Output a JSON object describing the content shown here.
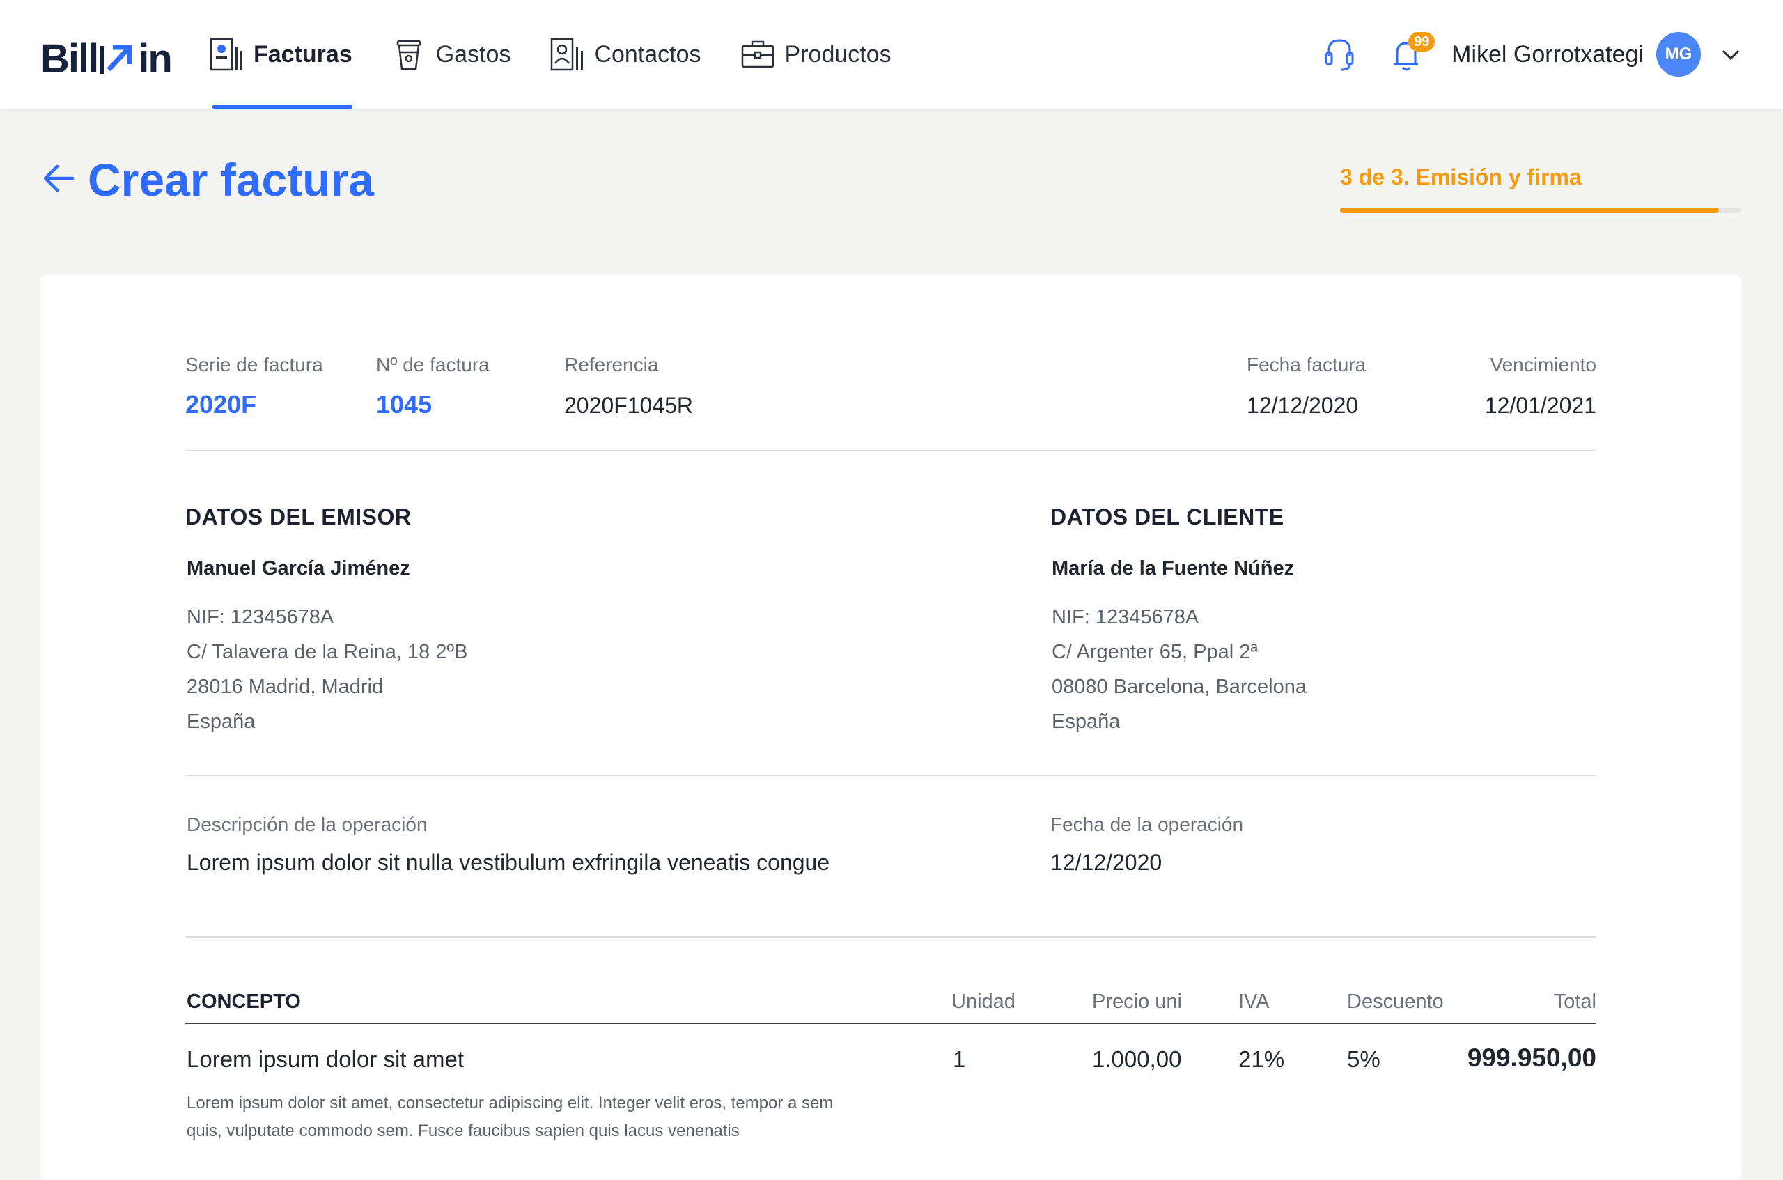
{
  "app": {
    "logo_left": "Bill",
    "logo_right": "in"
  },
  "nav": {
    "items": [
      {
        "label": "Facturas",
        "icon": "invoice-icon",
        "active": true
      },
      {
        "label": "Gastos",
        "icon": "cup-icon",
        "active": false
      },
      {
        "label": "Contactos",
        "icon": "contacts-icon",
        "active": false
      },
      {
        "label": "Productos",
        "icon": "briefcase-icon",
        "active": false
      }
    ]
  },
  "header_tools": {
    "notifications_count": "99",
    "user_name": "Mikel Gorrotxategi",
    "avatar_initials": "MG"
  },
  "page": {
    "title": "Crear factura",
    "step_label": "3 de 3. Emisión y firma",
    "step_progress": 0.945
  },
  "invoice": {
    "series_label": "Serie de factura",
    "series": "2020F",
    "number_label": "Nº de factura",
    "number": "1045",
    "reference_label": "Referencia",
    "reference": "2020F1045R",
    "date_label": "Fecha factura",
    "date": "12/12/2020",
    "due_label": "Vencimiento",
    "due": "12/01/2021",
    "issuer": {
      "title": "DATOS DEL EMISOR",
      "name": "Manuel García Jiménez",
      "nif": "NIF: 12345678A",
      "address": "C/ Talavera de la Reina, 18 2ºB",
      "city": "28016 Madrid, Madrid",
      "country": "España"
    },
    "client": {
      "title": "DATOS DEL CLIENTE",
      "name": "María de la Fuente Núñez",
      "nif": "NIF: 12345678A",
      "address": "C/ Argenter 65, Ppal 2ª",
      "city": "08080 Barcelona, Barcelona",
      "country": "España"
    },
    "operation_desc_label": "Descripción de la operación",
    "operation_desc": "Lorem ipsum dolor sit nulla vestibulum exfringila veneatis congue",
    "operation_date_label": "Fecha de la operación",
    "operation_date": "12/12/2020",
    "table": {
      "headers": {
        "concept": "CONCEPTO",
        "unit": "Unidad",
        "price": "Precio uni",
        "vat": "IVA",
        "discount": "Descuento",
        "total": "Total"
      },
      "rows": [
        {
          "concept": "Lorem ipsum dolor sit amet",
          "unit": "1",
          "price": "1.000,00",
          "vat": "21%",
          "discount": "5%",
          "total": "999.950,00",
          "description": "Lorem ipsum dolor sit amet, consectetur adipiscing elit. Integer velit eros, tempor a sem quis, vulputate commodo sem. Fusce faucibus sapien quis lacus venenatis"
        }
      ]
    }
  },
  "colors": {
    "accent": "#2f6bff",
    "step": "#f49b13",
    "avatar": "#4a86f5"
  }
}
